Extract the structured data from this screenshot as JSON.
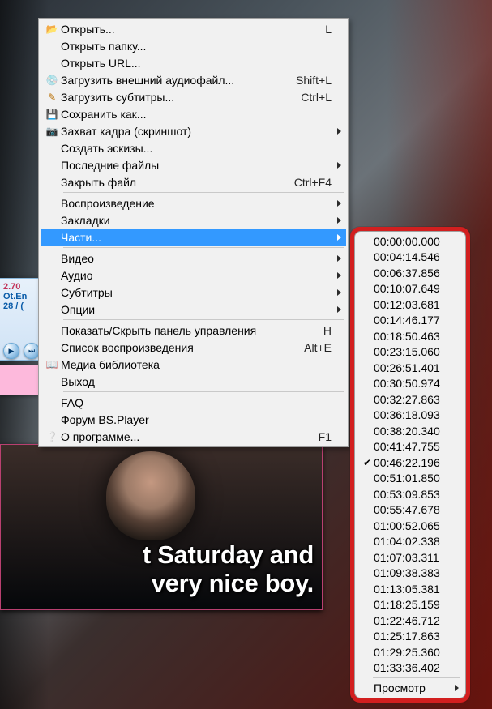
{
  "player": {
    "version": "2.70",
    "file_fragment": "Ot.En",
    "time_fragment": "28 / (",
    "subtitle_line1": "t Saturday and",
    "subtitle_line2": " very nice boy."
  },
  "menu": {
    "group1": [
      {
        "icon": "folder",
        "label": "Открыть...",
        "shortcut": "L",
        "submenu": false
      },
      {
        "icon": "",
        "label": "Открыть папку...",
        "shortcut": "",
        "submenu": false
      },
      {
        "icon": "",
        "label": "Открыть URL...",
        "shortcut": "",
        "submenu": false
      },
      {
        "icon": "cd",
        "label": "Загрузить внешний аудиофайл...",
        "shortcut": "Shift+L",
        "submenu": false
      },
      {
        "icon": "sub",
        "label": "Загрузить субтитры...",
        "shortcut": "Ctrl+L",
        "submenu": false
      },
      {
        "icon": "save",
        "label": "Сохранить как...",
        "shortcut": "",
        "submenu": false
      },
      {
        "icon": "cam",
        "label": "Захват кадра (скриншот)",
        "shortcut": "",
        "submenu": true
      },
      {
        "icon": "",
        "label": "Создать эскизы...",
        "shortcut": "",
        "submenu": false
      },
      {
        "icon": "",
        "label": "Последние файлы",
        "shortcut": "",
        "submenu": true
      },
      {
        "icon": "",
        "label": "Закрыть файл",
        "shortcut": "Ctrl+F4",
        "submenu": false
      }
    ],
    "group2": [
      {
        "icon": "",
        "label": "Воспроизведение",
        "shortcut": "",
        "submenu": true
      },
      {
        "icon": "",
        "label": "Закладки",
        "shortcut": "",
        "submenu": true
      },
      {
        "icon": "",
        "label": "Части...",
        "shortcut": "",
        "submenu": true,
        "highlight": true
      }
    ],
    "group3": [
      {
        "icon": "",
        "label": "Видео",
        "shortcut": "",
        "submenu": true
      },
      {
        "icon": "",
        "label": "Аудио",
        "shortcut": "",
        "submenu": true
      },
      {
        "icon": "",
        "label": "Субтитры",
        "shortcut": "",
        "submenu": true
      },
      {
        "icon": "",
        "label": "Опции",
        "shortcut": "",
        "submenu": true
      }
    ],
    "group4": [
      {
        "icon": "",
        "label": "Показать/Скрыть панель управления",
        "shortcut": "H",
        "submenu": false
      },
      {
        "icon": "",
        "label": "Список воспроизведения",
        "shortcut": "Alt+E",
        "submenu": false
      },
      {
        "icon": "book",
        "label": "Медиа библиотека",
        "shortcut": "",
        "submenu": false
      },
      {
        "icon": "",
        "label": "Выход",
        "shortcut": "",
        "submenu": false
      }
    ],
    "group5": [
      {
        "icon": "",
        "label": "FAQ",
        "shortcut": "",
        "submenu": false
      },
      {
        "icon": "",
        "label": "Форум BS.Player",
        "shortcut": "",
        "submenu": false
      },
      {
        "icon": "info",
        "label": "О программе...",
        "shortcut": "F1",
        "submenu": false
      }
    ]
  },
  "chapters": {
    "items": [
      {
        "time": "00:00:00.000",
        "current": false
      },
      {
        "time": "00:04:14.546",
        "current": false
      },
      {
        "time": "00:06:37.856",
        "current": false
      },
      {
        "time": "00:10:07.649",
        "current": false
      },
      {
        "time": "00:12:03.681",
        "current": false
      },
      {
        "time": "00:14:46.177",
        "current": false
      },
      {
        "time": "00:18:50.463",
        "current": false
      },
      {
        "time": "00:23:15.060",
        "current": false
      },
      {
        "time": "00:26:51.401",
        "current": false
      },
      {
        "time": "00:30:50.974",
        "current": false
      },
      {
        "time": "00:32:27.863",
        "current": false
      },
      {
        "time": "00:36:18.093",
        "current": false
      },
      {
        "time": "00:38:20.340",
        "current": false
      },
      {
        "time": "00:41:47.755",
        "current": false
      },
      {
        "time": "00:46:22.196",
        "current": true
      },
      {
        "time": "00:51:01.850",
        "current": false
      },
      {
        "time": "00:53:09.853",
        "current": false
      },
      {
        "time": "00:55:47.678",
        "current": false
      },
      {
        "time": "01:00:52.065",
        "current": false
      },
      {
        "time": "01:04:02.338",
        "current": false
      },
      {
        "time": "01:07:03.311",
        "current": false
      },
      {
        "time": "01:09:38.383",
        "current": false
      },
      {
        "time": "01:13:05.381",
        "current": false
      },
      {
        "time": "01:18:25.159",
        "current": false
      },
      {
        "time": "01:22:46.712",
        "current": false
      },
      {
        "time": "01:25:17.863",
        "current": false
      },
      {
        "time": "01:29:25.360",
        "current": false
      },
      {
        "time": "01:33:36.402",
        "current": false
      }
    ],
    "view_label": "Просмотр"
  }
}
